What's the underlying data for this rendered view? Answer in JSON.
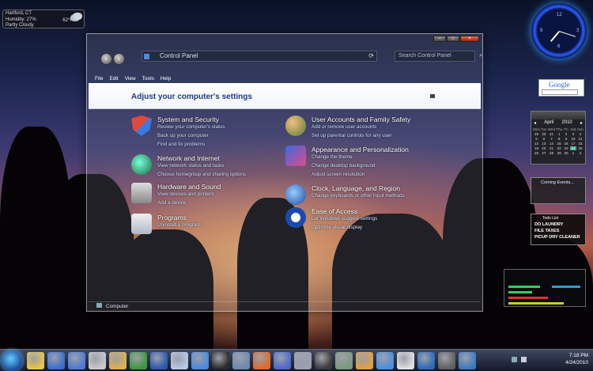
{
  "weather": {
    "city": "Hartford, CT",
    "humidity": "Humidity: 27%",
    "condition": "Partly Cloudy",
    "temp": "62°F"
  },
  "window": {
    "address_path": "Control Panel",
    "search_placeholder": "Search Control Panel",
    "menu": [
      "File",
      "Edit",
      "View",
      "Tools",
      "Help"
    ],
    "heading": "Adjust your computer's settings",
    "status": "Computer",
    "categories": [
      {
        "title": "System and Security",
        "links": [
          "Review your computer's status",
          "Back up your computer",
          "Find and fix problems"
        ]
      },
      {
        "title": "Network and Internet",
        "links": [
          "View network status and tasks",
          "Choose homegroup and sharing options"
        ]
      },
      {
        "title": "Hardware and Sound",
        "links": [
          "View devices and printers",
          "Add a device"
        ]
      },
      {
        "title": "Programs",
        "links": [
          "Uninstall a program"
        ]
      },
      {
        "title": "User Accounts and Family Safety",
        "links": [
          "Add or remove user accounts",
          "Set up parental controls for any user"
        ]
      },
      {
        "title": "Appearance and Personalization",
        "links": [
          "Change the theme",
          "Change desktop background",
          "Adjust screen resolution"
        ]
      },
      {
        "title": "Clock, Language, and Region",
        "links": [
          "Change keyboards or other input methods"
        ]
      },
      {
        "title": "Ease of Access",
        "links": [
          "Let Windows suggest settings",
          "Optimize visual display"
        ]
      }
    ]
  },
  "gadgets": {
    "google_label": "Google",
    "calendar": {
      "month": "April",
      "year": "2010",
      "weekdays": [
        "Mon",
        "Tue",
        "Wed",
        "Thu",
        "Fri",
        "Sat",
        "Sun"
      ],
      "days": [
        "29",
        "30",
        "31",
        "1",
        "2",
        "3",
        "4",
        "5",
        "6",
        "7",
        "8",
        "9",
        "10",
        "11",
        "12",
        "13",
        "14",
        "15",
        "16",
        "17",
        "18",
        "19",
        "20",
        "21",
        "22",
        "23",
        "24",
        "25",
        "26",
        "27",
        "28",
        "29",
        "30",
        "1",
        "2"
      ],
      "today": "24"
    },
    "events_title": "Coming Events...",
    "todo_title": "Todo List",
    "todo_items": [
      "DO LAUNDRY",
      "FILE TAXES",
      "PICUP DRY CLEANER"
    ]
  },
  "taskbar": {
    "time": "7:18 PM",
    "date": "4/24/2010",
    "icon_colors": [
      "#e8c64a",
      "#3a6fd0",
      "#4a7ad8",
      "#c9c9c9",
      "#e0b050",
      "#3a9a3a",
      "#2a5ab0",
      "#b8c8e8",
      "#4a8ae0",
      "#2a2a2a",
      "#6a8ab0",
      "#e06a2a",
      "#4a6ad0",
      "#9aa0b0",
      "#3a3a3a",
      "#7a9a7a",
      "#e0a040",
      "#4a90e0",
      "#e0e0e0",
      "#2a6ac0",
      "#606060",
      "#3a7ac0"
    ]
  }
}
